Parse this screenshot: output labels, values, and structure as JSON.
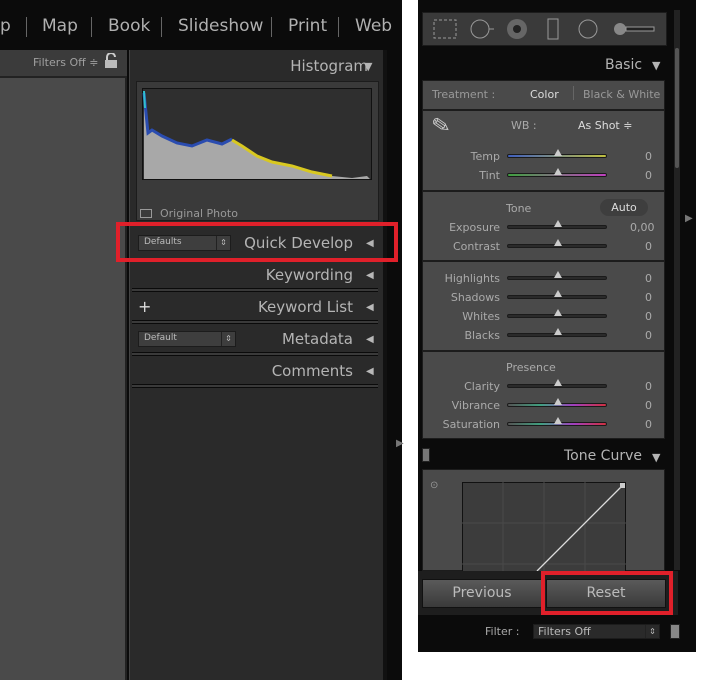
{
  "left": {
    "modules": [
      "p",
      "Map",
      "Book",
      "Slideshow",
      "Print",
      "Web"
    ],
    "filters_label": "Filters Off ≑",
    "lock_icon": "padlock-icon",
    "panels": {
      "histogram": "Histogram",
      "original_photo": "Original Photo",
      "quick_develop": "Quick Develop",
      "quick_develop_preset": "Defaults",
      "keywording": "Keywording",
      "keyword_list": "Keyword List",
      "metadata": "Metadata",
      "metadata_preset": "Default",
      "comments": "Comments"
    },
    "highlight_color": "#e0202a"
  },
  "right": {
    "tools": [
      "crop-overlay-icon",
      "spot-removal-icon",
      "red-eye-icon",
      "graduated-filter-icon",
      "radial-filter-icon",
      "adjustment-brush-icon"
    ],
    "basic": "Basic",
    "treatment_label": "Treatment :",
    "treatment_color": "Color",
    "treatment_bw": "Black & White",
    "wb_label": "WB :",
    "wb_value": "As Shot ≑",
    "tone_label": "Tone",
    "auto": "Auto",
    "presence_label": "Presence",
    "wb_sliders": [
      {
        "label": "Temp",
        "value": "0"
      },
      {
        "label": "Tint",
        "value": "0"
      }
    ],
    "tone_sliders": [
      {
        "label": "Exposure",
        "value": "0,00"
      },
      {
        "label": "Contrast",
        "value": "0"
      }
    ],
    "tone2_sliders": [
      {
        "label": "Highlights",
        "value": "0"
      },
      {
        "label": "Shadows",
        "value": "0"
      },
      {
        "label": "Whites",
        "value": "0"
      },
      {
        "label": "Blacks",
        "value": "0"
      }
    ],
    "presence_sliders": [
      {
        "label": "Clarity",
        "value": "0"
      },
      {
        "label": "Vibrance",
        "value": "0"
      },
      {
        "label": "Saturation",
        "value": "0"
      }
    ],
    "tone_curve": "Tone Curve",
    "previous": "Previous",
    "reset": "Reset",
    "filter_label": "Filter :",
    "filter_value": "Filters Off"
  }
}
